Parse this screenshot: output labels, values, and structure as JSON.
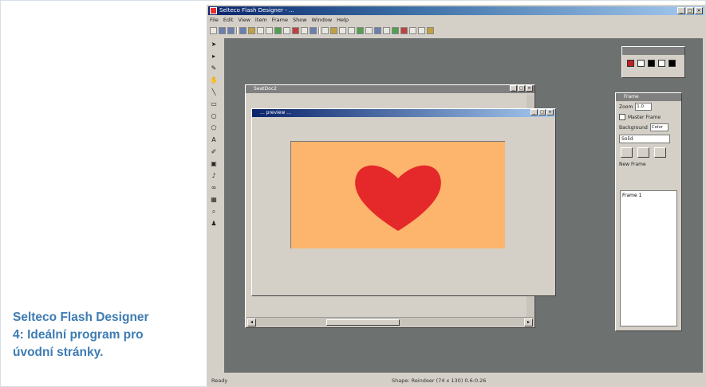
{
  "caption": {
    "lines": [
      "Selteco Flash Designer",
      "4: Ideální program pro",
      "úvodní stránky."
    ]
  },
  "app": {
    "title": "Selteco Flash Designer - ...",
    "menu": [
      "File",
      "Edit",
      "View",
      "Item",
      "Frame",
      "Show",
      "Window",
      "Help"
    ],
    "status_left": "Ready",
    "status_mid": "Shape: Reindeer (74 x 130) 0.6:0.26"
  },
  "doc_window_back": {
    "title": "SeatDoc2"
  },
  "doc_window_front": {
    "title": "... preview ..."
  },
  "panel": {
    "title": "Frame",
    "zoom_label": "Zoom",
    "zoom_value": "1.0",
    "checkbox_label": "Master Frame",
    "background_label": "Background",
    "background_value": "Color",
    "fill_value": "Solid",
    "list_header": "New Frame",
    "frame_item": "Frame 1"
  },
  "colors": {
    "workspace": "#6d7170",
    "canvas": "#fdb46c",
    "heart": "#e52829",
    "caption": "#3e7cb3"
  },
  "icons": [
    "arrow-icon",
    "node-icon",
    "pen-icon",
    "rectangle-icon",
    "ellipse-icon",
    "text-icon",
    "zoom-icon",
    "heart-shape"
  ]
}
